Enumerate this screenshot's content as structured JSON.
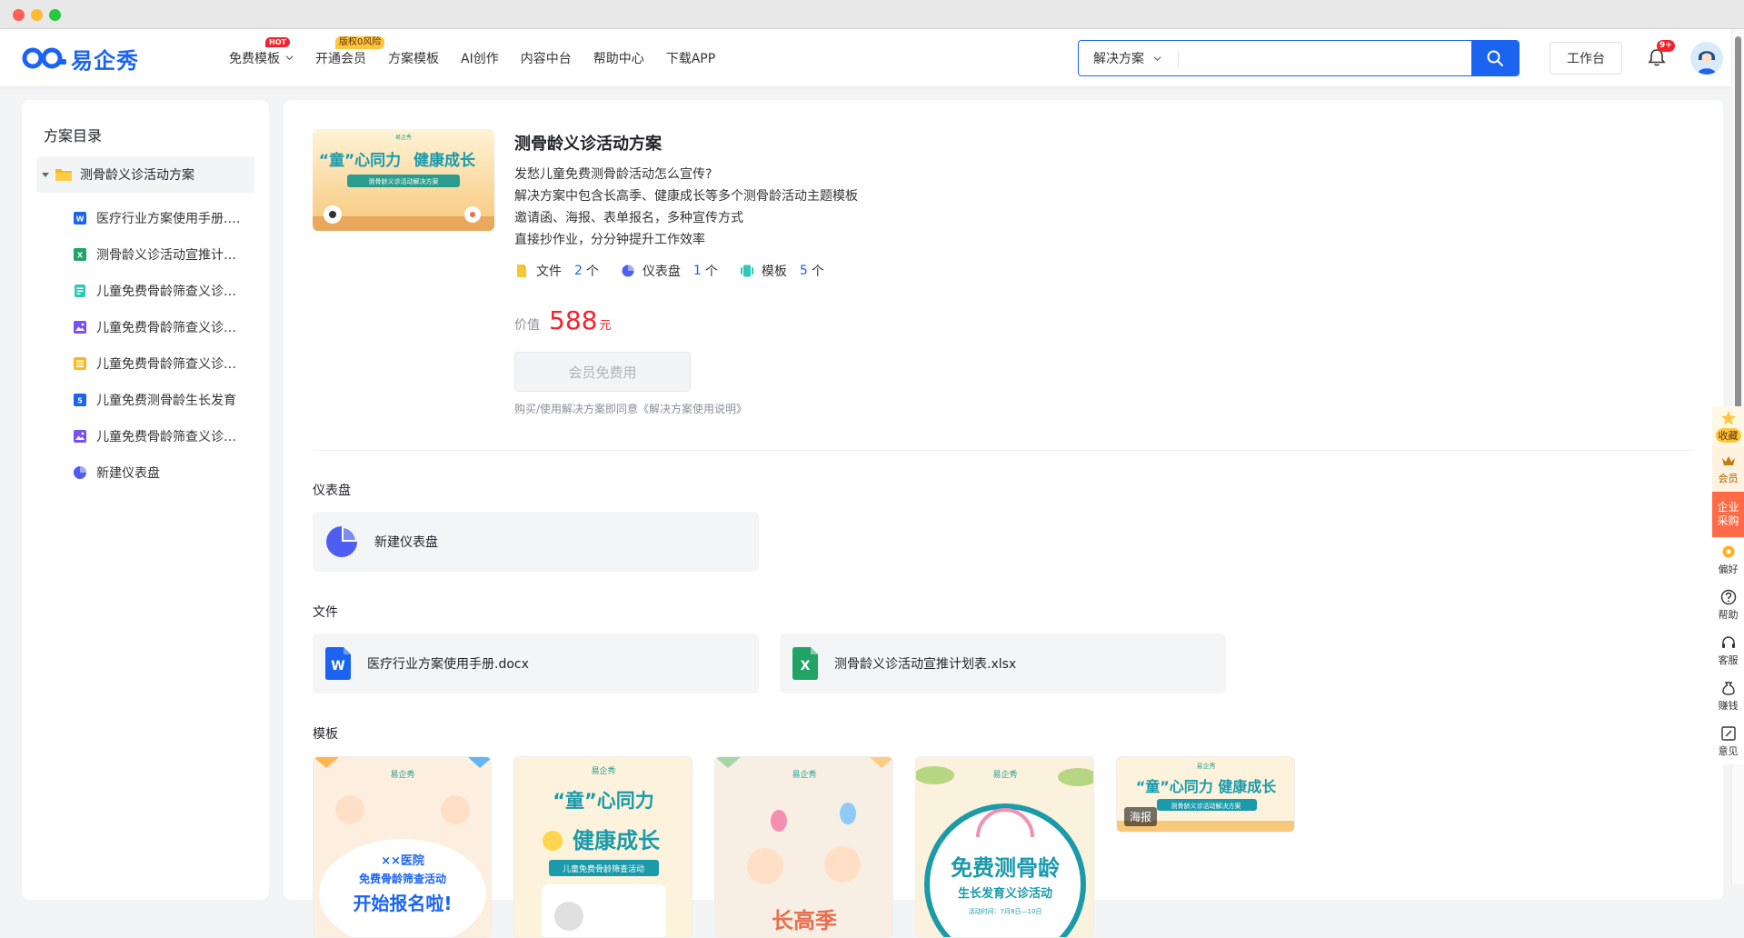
{
  "brand": {
    "name": "易企秀",
    "color": "#1b64f2"
  },
  "nav": {
    "items": [
      {
        "label": "免费模板",
        "badge": "HOT",
        "has_dropdown": true
      },
      {
        "label": "开通会员",
        "badge": "版权0风险"
      },
      {
        "label": "方案模板"
      },
      {
        "label": "AI创作"
      },
      {
        "label": "内容中台"
      },
      {
        "label": "帮助中心"
      },
      {
        "label": "下载APP"
      }
    ]
  },
  "search": {
    "category": "解决方案",
    "value": "",
    "placeholder": ""
  },
  "header": {
    "workbench_label": "工作台",
    "notification_badge": "9+"
  },
  "sidebar": {
    "title": "方案目录",
    "root": "测骨龄义诊活动方案",
    "items": [
      {
        "label": "医疗行业方案使用手册.docx",
        "icon": "word-icon"
      },
      {
        "label": "测骨龄义诊活动宣推计划表.xlsx",
        "icon": "excel-icon"
      },
      {
        "label": "儿童免费骨龄筛查义诊活动",
        "icon": "form-icon"
      },
      {
        "label": "儿童免费骨龄筛查义诊活动",
        "icon": "poster-icon"
      },
      {
        "label": "儿童免费骨龄筛查义诊活动",
        "icon": "long-page-icon"
      },
      {
        "label": "儿童免费测骨龄生长发育",
        "icon": "h5-icon"
      },
      {
        "label": "儿童免费骨龄筛查义诊活动",
        "icon": "poster-icon"
      },
      {
        "label": "新建仪表盘",
        "icon": "dashboard-icon"
      }
    ]
  },
  "solution": {
    "cover": {
      "title_a": "“童”心同力",
      "title_b": "健康成长",
      "subtitle": "测骨龄义诊活动解决方案",
      "brand": "易企秀"
    },
    "title": "测骨龄义诊活动方案",
    "desc": [
      "发愁儿童免费测骨龄活动怎么宣传?",
      "解决方案中包含长高季、健康成长等多个测骨龄活动主题模板",
      "邀请函、海报、表单报名，多种宣传方式",
      "直接抄作业，分分钟提升工作效率"
    ],
    "stats": [
      {
        "label": "文件",
        "count": "2",
        "unit": "个"
      },
      {
        "label": "仪表盘",
        "count": "1",
        "unit": "个"
      },
      {
        "label": "模板",
        "count": "5",
        "unit": "个"
      }
    ],
    "price_label": "价值",
    "price": "588",
    "price_unit": "元",
    "button_label": "会员免费用",
    "agreement": "购买/使用解决方案即同意《解决方案使用说明》"
  },
  "sections": {
    "dashboard": {
      "title": "仪表盘",
      "cards": [
        {
          "label": "新建仪表盘"
        }
      ]
    },
    "files": {
      "title": "文件",
      "cards": [
        {
          "label": "医疗行业方案使用手册.docx",
          "icon_letter": "W"
        },
        {
          "label": "测骨龄义诊活动宣推计划表.xlsx",
          "icon_letter": "X"
        }
      ]
    },
    "templates": {
      "title": "模板",
      "items": [
        {
          "brand": "易企秀",
          "line1": "××医院",
          "line2": "免费骨龄筛查活动",
          "line3": "开始报名啦!"
        },
        {
          "brand": "易企秀",
          "line1": "“童”心同力",
          "line2": "健康成长",
          "line3": "儿童免费骨龄筛查活动"
        },
        {
          "brand": "易企秀",
          "line1": "长高季"
        },
        {
          "brand": "易企秀",
          "line1": "免费测骨龄",
          "line2": "生长发育义诊活动",
          "line3": "活动时间：7月8日—10日"
        },
        {
          "brand": "易企秀",
          "line1": "“童”心同力 健康成长",
          "line2": "测骨龄义诊活动解决方案",
          "tag": "海报"
        }
      ]
    }
  },
  "floatbar": {
    "items": [
      {
        "label": "收藏"
      },
      {
        "label": "会员"
      },
      {
        "label": "企业采购"
      },
      {
        "label": "偏好"
      },
      {
        "label": "帮助"
      },
      {
        "label": "客服"
      },
      {
        "label": "赚钱"
      },
      {
        "label": "意见"
      }
    ]
  }
}
